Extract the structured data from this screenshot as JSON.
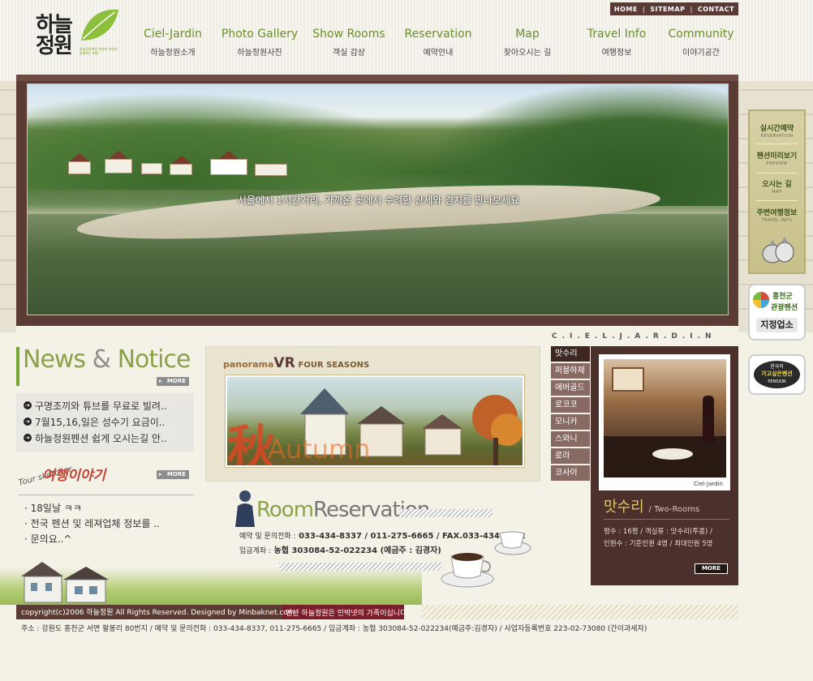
{
  "logo": {
    "text": "하늘정원",
    "sub": "하늘정원펜션 천연의 자연과 함께하는 펜션"
  },
  "util": {
    "home": "HOME",
    "sitemap": "SITEMAP",
    "contact": "CONTACT"
  },
  "nav": [
    {
      "en": "Ciel-Jardin",
      "ko": "하늘정원소개"
    },
    {
      "en": "Photo Gallery",
      "ko": "하늘정원사진"
    },
    {
      "en": "Show Rooms",
      "ko": "객실 감상"
    },
    {
      "en": "Reservation",
      "ko": "예약안내"
    },
    {
      "en": "Map",
      "ko": "찾아오시는 길"
    },
    {
      "en": "Travel Info",
      "ko": "여행정보"
    },
    {
      "en": "Community",
      "ko": "이야기공간"
    }
  ],
  "banner": {
    "caption": "서울에서 1시간거리, 가까운 곳에서 수려한 산세와 경치를 만나보세요"
  },
  "quick": [
    {
      "ko": "실시간예약",
      "en": "RESERVATION"
    },
    {
      "ko": "펜션미리보기",
      "en": "PREVIEW"
    },
    {
      "ko": "오시는 길",
      "en": "MAP"
    },
    {
      "ko": "주변여행정보",
      "en": "TRAVEL INFO"
    }
  ],
  "badges": {
    "hongcheon": {
      "line1": "홍천군",
      "line2": "관광펜션",
      "line3": "지정업소"
    },
    "best_pension": {
      "line1": "한국의",
      "line2": "가고싶은펜션",
      "line3": "PENSION"
    }
  },
  "news": {
    "title_a": "News",
    "title_amp": "&",
    "title_b": "Notice",
    "more": "MORE",
    "items": [
      "구명조끼와 튜브를 무료로 빌려..",
      "7월15,16,일은 성수기 요금이..",
      "하늘정원펜션 쉽게 오시는길 안.."
    ]
  },
  "tour": {
    "word": "Tour sketcher",
    "title": "여행이야기",
    "more": "MORE",
    "items": [
      "18일날 ㅋㅋ",
      "전국 펜션 및 레져업체 정보를 ..",
      "문의요..^"
    ]
  },
  "panorama": {
    "label": "panorama",
    "vr": "VR",
    "seasons": "FOUR SEASONS",
    "season_char": "秋",
    "season_word": "Autumn"
  },
  "reservation": {
    "title_a": "Room",
    "title_b": "Reservation",
    "phone_label": "예약 및 문의전화 :",
    "phone": "033-434-8337 / 011-275-6665 / FAX.033-434-6632",
    "account_label": "입금계좌 :",
    "account": "농협 303084-52-022234 (예금주 : 김경자)"
  },
  "rooms": {
    "brand": "C.I.E.L.J.A.R.D.I.N",
    "items": [
      "맛수리",
      "퍼블하제",
      "에버골드",
      "로코코",
      "모니카",
      "스와니",
      "로라",
      "코사이"
    ],
    "selected": {
      "name": "맛수리",
      "type": "/ Two-Rooms",
      "photo_caption": "Ciel-Jardin",
      "info1": "평수 : 16평 / 객실류 : 맛수리(투룸) /",
      "info2": "인원수 : 기준인원 4명 / 최대인원 5명",
      "more": "MORE"
    }
  },
  "footer": {
    "copyright": "copyright(c)2006 하늘정원 All Rights Reserved. Designed by Minbaknet.com.",
    "tag": "펜션 하늘정원은 민박넷의 가족이십니다.",
    "address": "주소 : 강원도 홍천군 서면 팔봉리 80번지 / 예약 및 문의전화 : 033-434-8337, 011-275-6665 / 입금계좌 : 농협 303084-52-022234(예금주:김경자) / 사업자등록번호 223-02-73080 (간이과세자)"
  },
  "colors": {
    "brown": "#5b3c35",
    "green": "#8aa24a",
    "wine": "#7a1e2c"
  }
}
